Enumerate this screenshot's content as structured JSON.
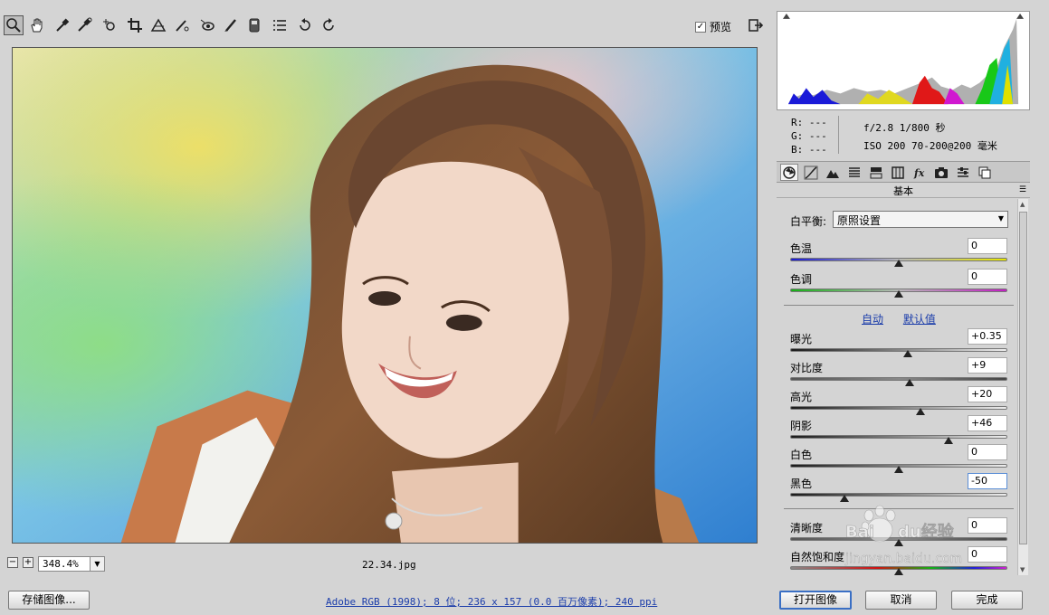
{
  "toolbar": {
    "tools": [
      "zoom-tool-icon",
      "hand-tool-icon",
      "white-balance-tool-icon",
      "color-sampler-tool-icon",
      "target-adjustment-tool-icon",
      "crop-tool-icon",
      "straighten-tool-icon",
      "spot-removal-tool-icon",
      "red-eye-removal-tool-icon",
      "adjustment-brush-icon",
      "graduated-filter-icon",
      "preferences-icon",
      "rotate-ccw-icon",
      "rotate-cw-icon"
    ],
    "preview_label": "预览",
    "preview_checked": true
  },
  "image": {
    "zoom": "348.4%",
    "filename": "22.34.jpg"
  },
  "info": {
    "r": "R:  ---",
    "g": "G:  ---",
    "b": "B:  ---",
    "aperture_shutter": "f/2.8   1/800 秒",
    "iso_lens": "ISO 200   70-200@200 毫米"
  },
  "panel": {
    "title": "基本",
    "white_balance_label": "白平衡:",
    "white_balance_value": "原照设置",
    "auto_label": "自动",
    "default_label": "默认值",
    "sliders": [
      {
        "label": "色温",
        "value": "0",
        "level": 0.5
      },
      {
        "label": "色调",
        "value": "0",
        "level": 0.5
      },
      {
        "label": "曝光",
        "value": "+0.35",
        "level": 0.54
      },
      {
        "label": "对比度",
        "value": "+9",
        "level": 0.55
      },
      {
        "label": "高光",
        "value": "+20",
        "level": 0.6
      },
      {
        "label": "阴影",
        "value": "+46",
        "level": 0.73
      },
      {
        "label": "白色",
        "value": "0",
        "level": 0.5
      },
      {
        "label": "黑色",
        "value": "-50",
        "level": 0.25
      },
      {
        "label": "清晰度",
        "value": "0",
        "level": 0.5
      },
      {
        "label": "自然饱和度",
        "value": "0",
        "level": 0.5
      }
    ]
  },
  "footer": {
    "save_label": "存储图像...",
    "info_text": "Adobe RGB (1998); 8 位; 236 x 157 (0.0 百万像素); 240 ppi",
    "open_label": "打开图像",
    "cancel_label": "取消",
    "done_label": "完成"
  },
  "watermark": {
    "text": "Baidu经验",
    "url": "jingyan.baidu.com"
  }
}
